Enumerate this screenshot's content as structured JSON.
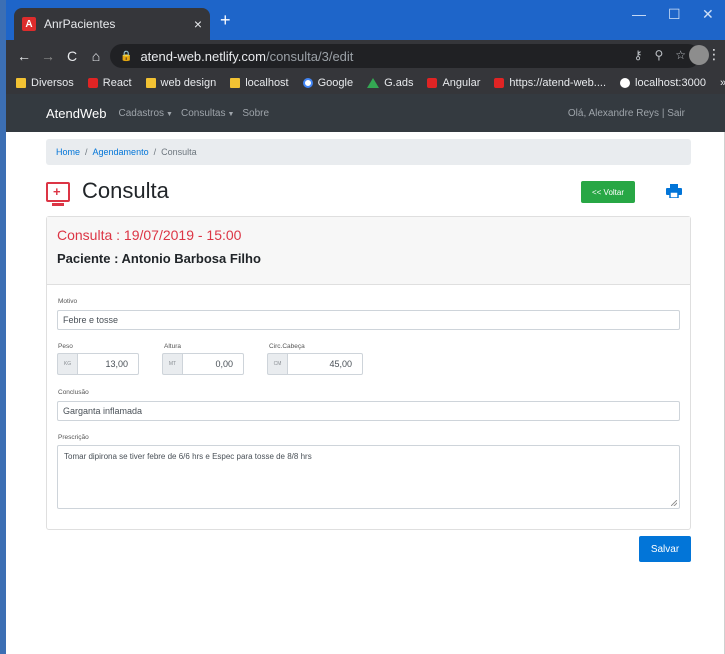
{
  "browser": {
    "tab_title": "AnrPacientes",
    "url_host": "atend-web.netlify.com",
    "url_path": "/consulta/3/edit",
    "bookmarks": [
      "Diversos",
      "React",
      "web design",
      "localhost",
      "Google",
      "G.ads",
      "Angular",
      "https://atend-web....",
      "localhost:3000"
    ],
    "bookmarks_more": "»"
  },
  "appnav": {
    "brand": "AtendWeb",
    "links": [
      "Cadastros",
      "Consultas",
      "Sobre"
    ],
    "user_text": "Olá, Alexandre Reys | Sair"
  },
  "breadcrumb": {
    "home": "Home",
    "agendamento": "Agendamento",
    "current": "Consulta",
    "separator": "/"
  },
  "page": {
    "title": "Consulta",
    "voltar_label": "<< Voltar",
    "salvar_label": "Salvar"
  },
  "card": {
    "consulta": "Consulta : 19/07/2019 - 15:00",
    "paciente": "Paciente : Antonio Barbosa Filho"
  },
  "form": {
    "motivo_label": "Motivo",
    "motivo_value": "Febre e tosse",
    "peso_label": "Peso",
    "peso_unit": "KG",
    "peso_value": "13,00",
    "altura_label": "Altura",
    "altura_unit": "MT",
    "altura_value": "0,00",
    "circ_label": "Circ.Cabeça",
    "circ_unit": "CM",
    "circ_value": "45,00",
    "conclusao_label": "Conclusão",
    "conclusao_value": "Garganta inflamada",
    "prescricao_label": "Prescrição",
    "prescricao_value": "Tomar dipirona se tiver febre de 6/6 hrs e Espec para tosse de 8/8 hrs"
  },
  "colors": {
    "accent_red": "#dc3545",
    "btn_green": "#28a745",
    "btn_blue": "#0275d8",
    "navbar": "#343a40"
  }
}
